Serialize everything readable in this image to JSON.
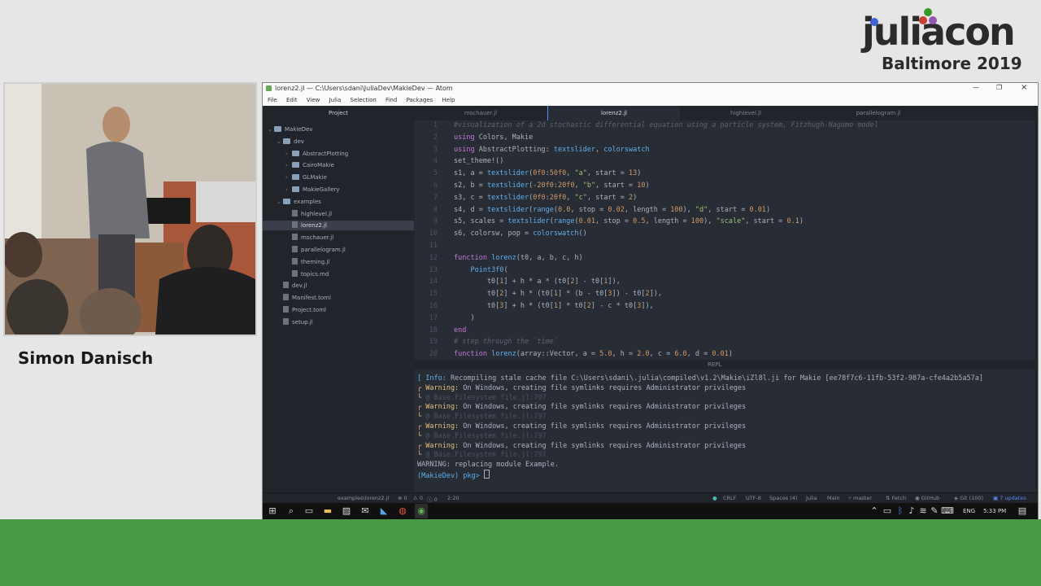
{
  "conference": {
    "name": "juliacon",
    "subtitle": "Baltimore 2019",
    "dot_colors": [
      "#4063d8",
      "#389826",
      "#cb3c33",
      "#9558b2"
    ]
  },
  "speaker": {
    "name": "Simon Danisch"
  },
  "window": {
    "title": "lorenz2.jl — C:\\Users\\sdani\\JuliaDev\\MakieDev — Atom",
    "menu": [
      "File",
      "Edit",
      "View",
      "Julia",
      "Selection",
      "Find",
      "Packages",
      "Help"
    ],
    "tabs": [
      "Project",
      "mschauer.jl",
      "lorenz2.jl",
      "highlevel.jl",
      "parallelogram.jl"
    ],
    "active_tab": "lorenz2.jl"
  },
  "tree": [
    {
      "label": "MakieDev",
      "type": "folder",
      "depth": 0
    },
    {
      "label": "dev",
      "type": "folder",
      "depth": 1
    },
    {
      "label": "AbstractPlotting",
      "type": "folder",
      "depth": 2
    },
    {
      "label": "CairoMakie",
      "type": "folder",
      "depth": 2
    },
    {
      "label": "GLMakie",
      "type": "folder",
      "depth": 2
    },
    {
      "label": "MakieGallery",
      "type": "folder",
      "depth": 2
    },
    {
      "label": "examples",
      "type": "folder",
      "depth": 1
    },
    {
      "label": "highlevel.jl",
      "type": "file",
      "depth": 2
    },
    {
      "label": "lorenz2.jl",
      "type": "file",
      "depth": 2,
      "selected": true
    },
    {
      "label": "mschauer.jl",
      "type": "file",
      "depth": 2
    },
    {
      "label": "parallelogram.jl",
      "type": "file",
      "depth": 2
    },
    {
      "label": "theming.jl",
      "type": "file",
      "depth": 2
    },
    {
      "label": "topics.md",
      "type": "file",
      "depth": 2
    },
    {
      "label": "dev.jl",
      "type": "file",
      "depth": 1
    },
    {
      "label": "Manifest.toml",
      "type": "file",
      "depth": 1
    },
    {
      "label": "Project.toml",
      "type": "file",
      "depth": 1
    },
    {
      "label": "setup.jl",
      "type": "file",
      "depth": 1
    }
  ],
  "code": [
    "#visualization of a 2d stochastic differential equation using a particle system, Fitzhugh-Nagumo model",
    "using Colors, Makie",
    "using AbstractPlotting: textslider, colorswatch",
    "set_theme!()",
    "s1, a = textslider(0f0:50f0, \"a\", start = 13)",
    "s2, b = textslider(-20f0:20f0, \"b\", start = 10)",
    "s3, c = textslider(0f0:20f0, \"c\", start = 2)",
    "s4, d = textslider(range(0.0, stop = 0.02, length = 100), \"d\", start = 0.01)",
    "s5, scales = textslider(range(0.01, stop = 0.5, length = 100), \"scale\", start = 0.1)",
    "s6, colorsw, pop = colorswatch()",
    "",
    "function lorenz(t0, a, b, c, h)",
    "    Point3f0(",
    "        t0[1] + h * a * (t0[2] - t0[1]),",
    "        t0[2] + h * (t0[1] * (b - t0[3]) - t0[2]),",
    "        t0[3] + h * (t0[1] * t0[2] - c * t0[3]),",
    "    )",
    "end",
    "# step through the `time`",
    "function lorenz(array::Vector, a = 5.0, h = 2.0, c = 6.0, d = 0.01)"
  ],
  "repl": {
    "header": "REPL",
    "lines": [
      {
        "prefix": "[ Info: ",
        "text": "Recompiling stale cache file C:\\Users\\sdani\\.julia\\compiled\\v1.2\\Makie\\iZl8l.ji for Makie [ee78f7c6-11fb-53f2-987a-cfe4a2b5a57a]"
      },
      {
        "prefix": "┌ Warning: ",
        "text": "On Windows, creating file symlinks requires Administrator privileges"
      },
      {
        "prefix": "└ ",
        "text": "@ Base.Filesystem file.jl:797"
      },
      {
        "prefix": "┌ Warning: ",
        "text": "On Windows, creating file symlinks requires Administrator privileges"
      },
      {
        "prefix": "└ ",
        "text": "@ Base.Filesystem file.jl:797"
      },
      {
        "prefix": "┌ Warning: ",
        "text": "On Windows, creating file symlinks requires Administrator privileges"
      },
      {
        "prefix": "└ ",
        "text": "@ Base.Filesystem file.jl:797"
      },
      {
        "prefix": "┌ Warning: ",
        "text": "On Windows, creating file symlinks requires Administrator privileges"
      },
      {
        "prefix": "└ ",
        "text": "@ Base.Filesystem file.jl:797"
      },
      {
        "prefix": "",
        "text": "WARNING: replacing module Example."
      },
      {
        "prefix": "(MakieDev) pkg> ",
        "text": ""
      }
    ]
  },
  "status": {
    "file": "examples\\lorenz2.jl",
    "errors": "0",
    "warnings": "0",
    "infos": "0",
    "cursor": "2:20",
    "line_ending": "CRLF",
    "encoding": "UTF-8",
    "indent": "Spaces (4)",
    "grammar": "Julia",
    "module": "Main",
    "branch": "master",
    "fetch": "Fetch",
    "github": "GitHub",
    "git": "Git (100)",
    "updates": "7 updates"
  },
  "taskbar": {
    "language": "ENG",
    "time": "5:33 PM"
  }
}
